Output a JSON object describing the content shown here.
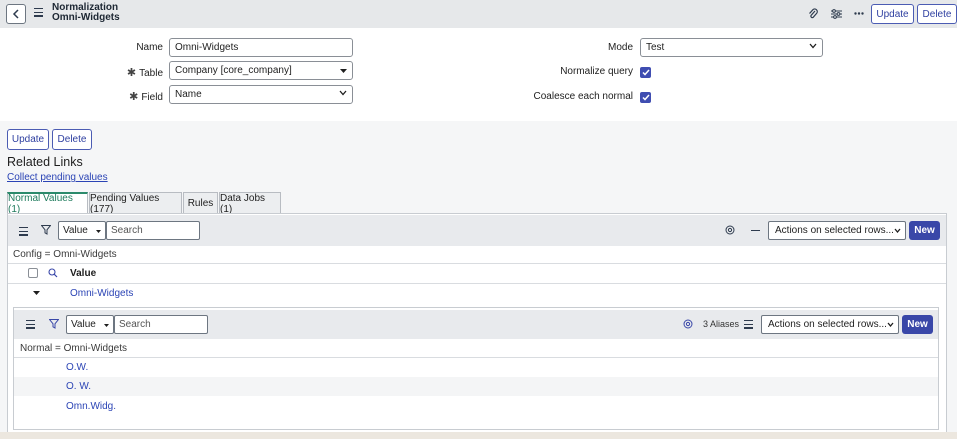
{
  "header": {
    "title_line1": "Normalization",
    "title_line2": "Omni-Widgets",
    "update_label": "Update",
    "delete_label": "Delete"
  },
  "form": {
    "name_label": "Name",
    "name_value": "Omni-Widgets",
    "table_label": "Table",
    "table_value": "Company [core_company]",
    "field_label": "Field",
    "field_value": "Name",
    "mode_label": "Mode",
    "mode_value": "Test",
    "normalize_query_label": "Normalize query",
    "normalize_query_checked": true,
    "coalesce_label": "Coalesce each normal",
    "coalesce_checked": true,
    "required_marker": "✱"
  },
  "bottom_buttons": {
    "update_label": "Update",
    "delete_label": "Delete"
  },
  "related": {
    "title": "Related Links",
    "link": "Collect pending values"
  },
  "tabs": [
    {
      "label": "Normal Values (1)",
      "active": true
    },
    {
      "label": "Pending Values (177)",
      "active": false
    },
    {
      "label": "Rules",
      "active": false
    },
    {
      "label": "Data Jobs (1)",
      "active": false
    }
  ],
  "list": {
    "filter_field": "Value",
    "search_placeholder": "Search",
    "actions_label": "Actions on selected rows...",
    "new_label": "New",
    "breadcrumb": "Config = Omni-Widgets",
    "column_header": "Value",
    "rows": [
      "Omni-Widgets"
    ]
  },
  "nested_list": {
    "filter_field": "Value",
    "search_placeholder": "Search",
    "aliases_count": "3",
    "aliases_label": "Aliases",
    "actions_label": "Actions on selected rows...",
    "new_label": "New",
    "breadcrumb": "Normal = Omni-Widgets",
    "rows": [
      "O.W.",
      "O. W.",
      "Omn.Widg."
    ]
  },
  "colors": {
    "accent": "#3947a8",
    "active_tab": "#2b8a6b",
    "link": "#2b44b5"
  }
}
